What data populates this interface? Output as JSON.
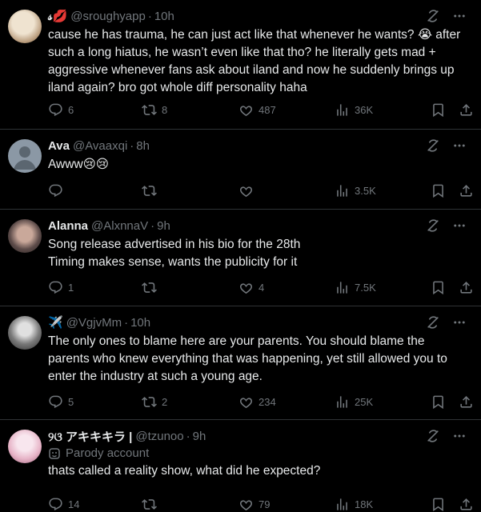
{
  "tweets": [
    {
      "name": "",
      "name_prefix": "𝓈",
      "emoji": "💋",
      "handle": "@sroughyapp",
      "time": "10h",
      "text": "cause he has trauma, he can just act like that whenever he wants? 😭 after such a long hiatus, he wasn’t even like that tho? he literally gets mad + aggressive whenever fans ask about iland and now he suddenly brings up iland again? bro got whole diff personality haha",
      "replies": "6",
      "reposts": "8",
      "likes": "487",
      "views": "36K",
      "avatar_color": "#d8c8b0"
    },
    {
      "name": "Ava",
      "handle": "@Avaaxqi",
      "time": "8h",
      "text": "Awww😢😢",
      "replies": "",
      "reposts": "",
      "likes": "",
      "views": "3.5K",
      "avatar_color": "#8b98a5"
    },
    {
      "name": "Alanna",
      "handle": "@AlxnnaV",
      "time": "9h",
      "text": "Song release advertised in his bio for the 28th\nTiming makes sense, wants the publicity for it",
      "replies": "1",
      "reposts": "",
      "likes": "4",
      "views": "7.5K",
      "avatar_color": "#6b5a55"
    },
    {
      "name": "✈️",
      "handle": "@VgjvMm",
      "time": "10h",
      "text": "The only ones to blame here are your parents. You should blame the parents who knew everything that was happening, yet still allowed you to enter the industry at such a young age.",
      "replies": "5",
      "reposts": "2",
      "likes": "234",
      "views": "25K",
      "avatar_color": "#b5b5b5"
    },
    {
      "name": "୨ଓ アキキキラ |",
      "handle": "@tzunoo",
      "time": "9h",
      "parody": "Parody account",
      "text": "thats called a reality show, what did he expected?",
      "replies": "14",
      "reposts": "",
      "likes": "79",
      "views": "18K",
      "avatar_color": "#f0d0e0"
    }
  ],
  "colors": {
    "bg": "#000000",
    "text": "#e7e9ea",
    "muted": "#71767b",
    "divider": "#2f3336"
  }
}
